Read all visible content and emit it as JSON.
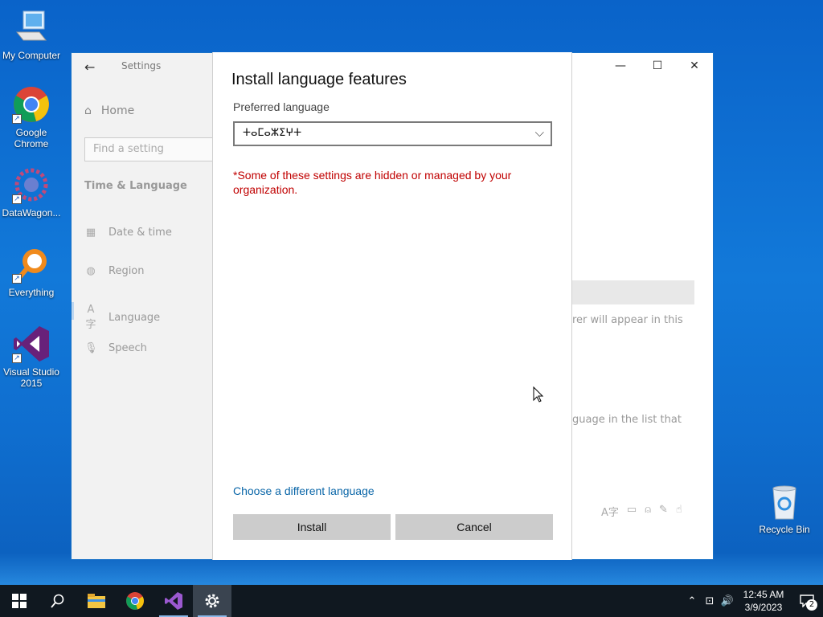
{
  "desktop": {
    "icons": [
      {
        "label": "My Computer",
        "icon": "computer-icon"
      },
      {
        "label": "Google Chrome",
        "icon": "chrome-icon"
      },
      {
        "label": "DataWagon...",
        "icon": "datawagon-icon"
      },
      {
        "label": "Everything",
        "icon": "everything-icon"
      },
      {
        "label": "Visual Studio 2015",
        "icon": "visual-studio-icon"
      }
    ],
    "recycle_bin": {
      "label": "Recycle Bin",
      "icon": "recycle-bin-icon"
    }
  },
  "settings_window": {
    "title": "Settings",
    "controls": {
      "minimize": "—",
      "maximize": "☐",
      "close": "✕"
    },
    "home_label": "Home",
    "search_placeholder": "Find a setting",
    "section_title": "Time & Language",
    "nav_items": [
      {
        "label": "Date & time",
        "icon": "calendar-clock-icon"
      },
      {
        "label": "Region",
        "icon": "globe-icon"
      },
      {
        "label": "Language",
        "icon": "language-icon",
        "selected": true
      },
      {
        "label": "Speech",
        "icon": "microphone-icon"
      }
    ],
    "background_text": {
      "line1": "rer will appear in this",
      "line2": "guage in the list that"
    }
  },
  "dialog": {
    "title": "Install language features",
    "preferred_label": "Preferred language",
    "selected_language": "ⵜⴰⵎⴰⵣⵉⵖⵜ",
    "warning": "*Some of these settings are hidden or managed by your organization.",
    "link": "Choose a different language",
    "install_label": "Install",
    "cancel_label": "Cancel"
  },
  "taskbar": {
    "time": "12:45 AM",
    "date": "3/9/2023",
    "notification_count": "2",
    "apps": [
      "windows-start-icon",
      "search-icon",
      "file-explorer-icon",
      "chrome-icon",
      "visual-studio-icon",
      "settings-gear-icon"
    ]
  },
  "colors": {
    "accent": "#0a66a8",
    "warning": "#c00000",
    "taskbar": "#101820"
  }
}
